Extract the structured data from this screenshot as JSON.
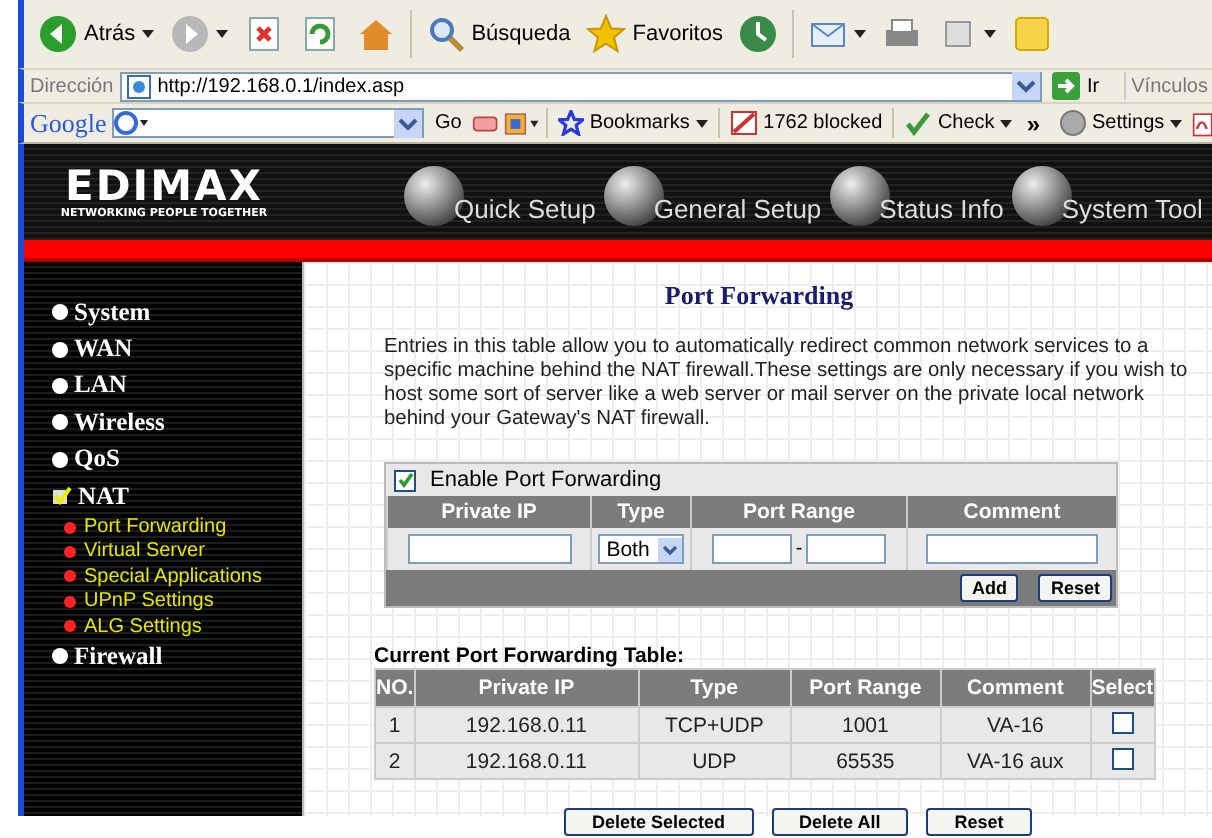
{
  "browser": {
    "toolbar": [
      {
        "kind": "back",
        "label": "Atrás",
        "menu": true
      },
      {
        "kind": "forward",
        "menu": true
      },
      {
        "kind": "stop"
      },
      {
        "kind": "refresh"
      },
      {
        "kind": "home"
      },
      {
        "kind": "search",
        "label": "Búsqueda"
      },
      {
        "kind": "favorites",
        "label": "Favoritos"
      },
      {
        "kind": "history"
      },
      {
        "kind": "mail",
        "menu": true
      },
      {
        "kind": "print"
      },
      {
        "kind": "fullscreen",
        "menu": true
      },
      {
        "kind": "note"
      }
    ],
    "address_label": "Dirección",
    "url": "http://192.168.0.1/index.asp",
    "go": "Ir",
    "links": "Vínculos",
    "google": {
      "logo": "Google",
      "go": "Go",
      "bookmarks": "Bookmarks",
      "blocked": "1762 blocked",
      "check": "Check",
      "more": "»",
      "settings": "Settings"
    }
  },
  "header": {
    "logo": "EDIMAX",
    "tagline": "NETWORKING PEOPLE TOGETHER",
    "nav": [
      {
        "label": "Quick Setup"
      },
      {
        "label": "General Setup"
      },
      {
        "label": "Status Info"
      },
      {
        "label": "System Tool"
      }
    ]
  },
  "sidebar": {
    "items": [
      {
        "label": "System",
        "selected": false
      },
      {
        "label": "WAN",
        "selected": false
      },
      {
        "label": "LAN",
        "selected": false
      },
      {
        "label": "Wireless",
        "selected": false
      },
      {
        "label": "QoS",
        "selected": false
      },
      {
        "label": "NAT",
        "selected": true,
        "children": [
          {
            "label": "Port Forwarding"
          },
          {
            "label": "Virtual Server"
          },
          {
            "label": "Special Applications"
          },
          {
            "label": "UPnP Settings"
          },
          {
            "label": "ALG Settings"
          }
        ]
      },
      {
        "label": "Firewall",
        "selected": false
      }
    ]
  },
  "content": {
    "title": "Port Forwarding",
    "description": "Entries in this table allow you to automatically redirect common network services to a specific machine behind the NAT firewall.These settings are only necessary if you wish to host some sort of server like a web server or mail server on the private local network behind your Gateway's NAT firewall.",
    "form": {
      "enable_label": "Enable Port Forwarding",
      "enable_checked": true,
      "columns": [
        "Private IP",
        "Type",
        "Port Range",
        "Comment"
      ],
      "type_value": "Both",
      "range_separator": "-",
      "buttons": [
        "Add",
        "Reset"
      ]
    },
    "table": {
      "title": "Current Port Forwarding Table:",
      "columns": [
        "NO.",
        "Private IP",
        "Type",
        "Port Range",
        "Comment",
        "Select"
      ],
      "rows": [
        {
          "cells": [
            "1",
            "192.168.0.11",
            "TCP+UDP",
            "1001",
            "VA-16"
          ],
          "selected": false
        },
        {
          "cells": [
            "2",
            "192.168.0.11",
            "UDP",
            "65535",
            "VA-16 aux"
          ],
          "selected": false
        }
      ]
    },
    "buttons": [
      "Delete Selected",
      "Delete All",
      "Reset"
    ]
  }
}
